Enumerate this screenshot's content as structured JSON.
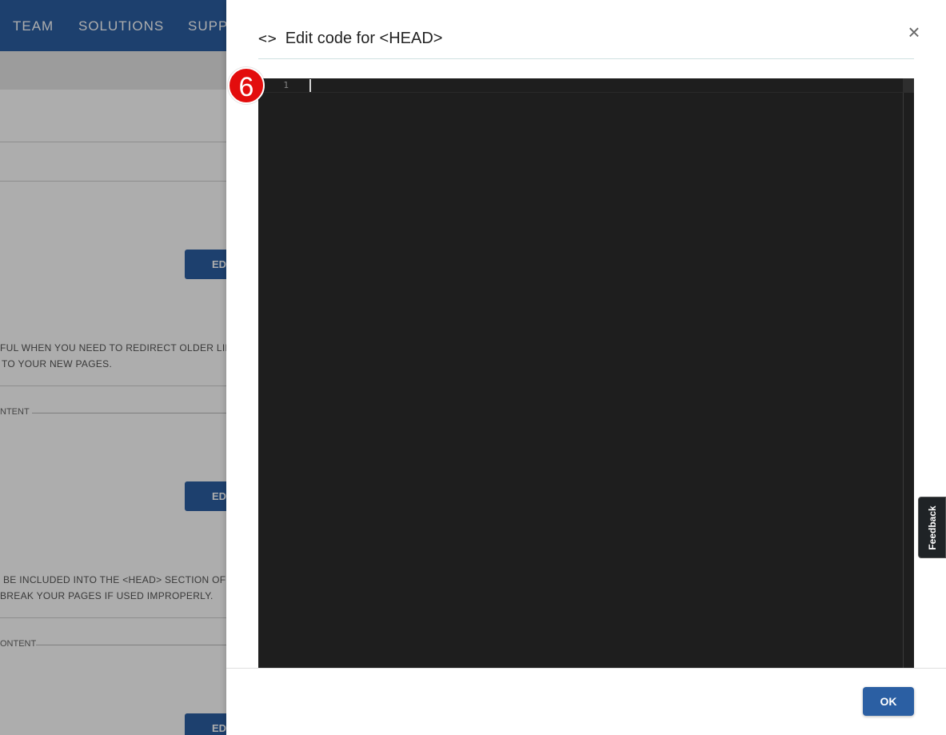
{
  "background": {
    "nav": [
      "TEAM",
      "SOLUTIONS",
      "SUPP"
    ],
    "edit_button_label": "EDI",
    "redirect_text": [
      "FUL WHEN YOU NEED TO REDIRECT OLDER LINKS",
      "TO YOUR NEW PAGES."
    ],
    "content_legend_1": "NTENT",
    "head_text": [
      "BE INCLUDED INTO THE <HEAD> SECTION OF EV",
      "BREAK YOUR PAGES IF USED IMPROPERLY."
    ],
    "content_legend_2": "ONTENT"
  },
  "dialog": {
    "icon": "code-brackets-icon",
    "title": "Edit code for <HEAD>",
    "close_glyph": "×",
    "editor": {
      "line_numbers": [
        "1"
      ]
    },
    "ok_label": "OK"
  },
  "step_badge": "6",
  "feedback_label": "Feedback",
  "colors": {
    "nav_blue": "#2b5fa3",
    "editor_bg": "#1e1e1e",
    "badge_red": "#e30d0d",
    "ok_button": "#2b5fa3"
  }
}
